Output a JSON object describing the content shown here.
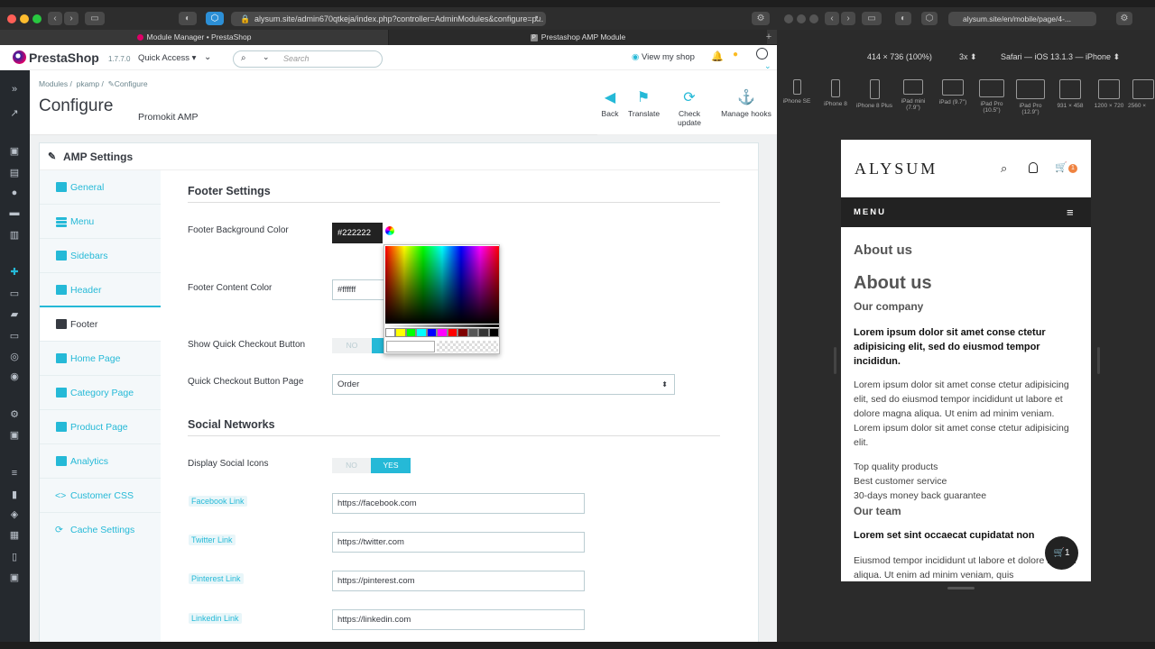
{
  "browser_left": {
    "url": "alysum.site/admin670qtkeja/index.php?controller=AdminModules&configure=p...",
    "tabs": [
      "Module Manager • PrestaShop",
      "Prestashop AMP Module"
    ]
  },
  "topbar": {
    "logo": "PrestaShop",
    "version": "1.7.7.0",
    "quick_access": "Quick Access",
    "search_placeholder": "Search",
    "view_shop": "View my shop"
  },
  "breadcrumb": [
    "Modules",
    "pkamp",
    "Configure"
  ],
  "page": {
    "title": "Configure",
    "module_name": "Promokit AMP",
    "toolbar": [
      "Back",
      "Translate",
      "Check update",
      "Manage hooks"
    ]
  },
  "panel": {
    "title": "AMP Settings",
    "tabs": [
      "General",
      "Menu",
      "Sidebars",
      "Header",
      "Footer",
      "Home Page",
      "Category Page",
      "Product Page",
      "Analytics",
      "Customer CSS",
      "Cache Settings"
    ],
    "footer_settings": {
      "title": "Footer Settings",
      "bg_color_label": "Footer Background Color",
      "bg_color_value": "#222222",
      "content_color_label": "Footer Content Color",
      "content_color_value": "#ffffff",
      "quick_checkout_label": "Show Quick Checkout Button",
      "quick_checkout_no": "NO",
      "quick_checkout_page_label": "Quick Checkout Button Page",
      "quick_checkout_page_value": "Order"
    },
    "social": {
      "title": "Social Networks",
      "display_label": "Display Social Icons",
      "no": "NO",
      "yes": "YES",
      "links": [
        {
          "label": "Facebook Link",
          "value": "https://facebook.com"
        },
        {
          "label": "Twitter Link",
          "value": "https://twitter.com"
        },
        {
          "label": "Pinterest Link",
          "value": "https://pinterest.com"
        },
        {
          "label": "Linkedin Link",
          "value": "https://linkedin.com"
        }
      ]
    }
  },
  "swatches": [
    "#ffffff",
    "#ffff00",
    "#00ff00",
    "#00ffff",
    "#0000ff",
    "#ff00ff",
    "#ff0000",
    "#7f0000",
    "#555555",
    "#333333",
    "#000000"
  ],
  "browser_right": {
    "url": "alysum.site/en/mobile/page/4-...",
    "viewport": "414 × 736",
    "zoom": "(100%)",
    "scale": "3x",
    "device": "Safari — iOS 13.1.3 — iPhone",
    "devices": [
      "iPhone SE",
      "iPhone 8",
      "iPhone 8 Plus",
      "iPad mini (7.9\")",
      "iPad (9.7\")",
      "iPad Pro (10.5\")",
      "iPad Pro (12.9\")",
      "931 × 458",
      "1200 × 720",
      "2560 ×"
    ]
  },
  "mobile": {
    "brand": "ALYSUM",
    "cart_count": "1",
    "menu": "MENU",
    "h_small": "About us",
    "h_big": "About us",
    "company": "Our company",
    "bold_para": "Lorem ipsum dolor sit amet conse ctetur adipisicing elit, sed do eiusmod tempor incididun.",
    "para": "Lorem ipsum dolor sit amet conse ctetur adipisicing elit, sed do eiusmod tempor incididunt ut labore et dolore magna aliqua. Ut enim ad minim veniam. Lorem ipsum dolor sit amet conse ctetur adipisicing elit.",
    "list": [
      "Top quality products",
      "Best customer service",
      "30-days money back guarantee"
    ],
    "team": "Our team",
    "team_bold": "Lorem set sint occaecat cupidatat non",
    "team_para": "Eiusmod tempor incididunt ut labore et dolore magna aliqua. Ut enim ad minim veniam, quis",
    "float_cart": "1"
  }
}
